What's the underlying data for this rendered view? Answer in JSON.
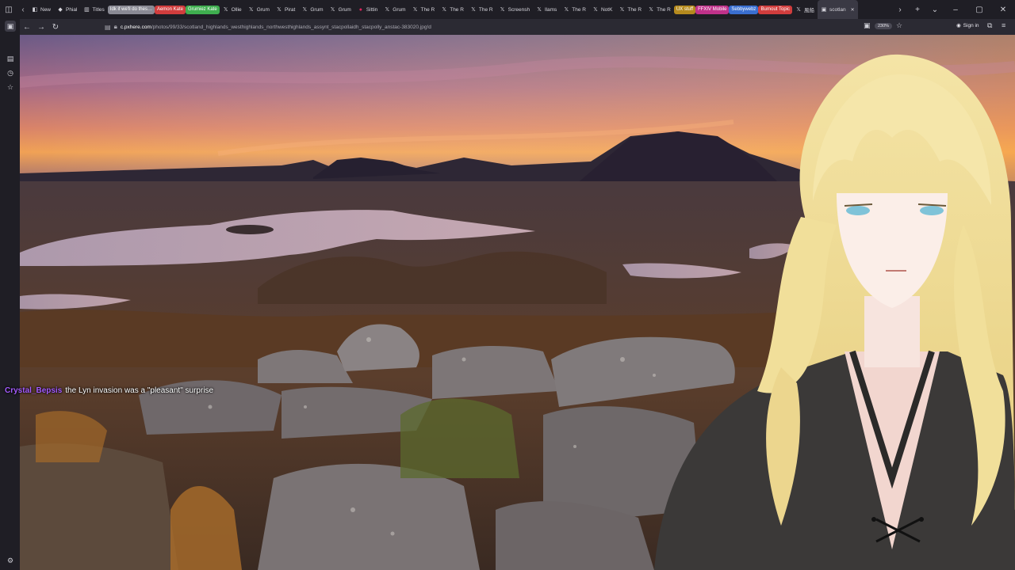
{
  "browser": {
    "tabs": [
      {
        "label": "New",
        "icon": "browser-icon"
      },
      {
        "label": "Phial",
        "icon": "shield-icon"
      },
      {
        "label": "Titles",
        "icon": "doc-icon"
      },
      {
        "label": "Idk if we'll do thes…",
        "group": "#8a8a94"
      },
      {
        "label": "Aemon Kate",
        "group": "#d13d3d"
      },
      {
        "label": "Grumiez Kate",
        "group": "#3fae4f"
      },
      {
        "label": "Ollie",
        "icon": "x-icon"
      },
      {
        "label": "Grum",
        "icon": "x-icon"
      },
      {
        "label": "Pirat",
        "icon": "x-icon"
      },
      {
        "label": "Grum",
        "icon": "x-icon"
      },
      {
        "label": "Grum",
        "icon": "x-icon"
      },
      {
        "label": "Sittin",
        "icon": "record-icon"
      },
      {
        "label": "Grum",
        "icon": "x-icon"
      },
      {
        "label": "The R",
        "icon": "x-icon"
      },
      {
        "label": "The R",
        "icon": "x-icon"
      },
      {
        "label": "The R",
        "icon": "x-icon"
      },
      {
        "label": "Screensh",
        "icon": "x-icon"
      },
      {
        "label": "llams",
        "icon": "x-icon"
      },
      {
        "label": "The R",
        "icon": "x-icon"
      },
      {
        "label": "NotK",
        "icon": "x-icon"
      },
      {
        "label": "The R",
        "icon": "x-icon"
      },
      {
        "label": "The R",
        "icon": "x-icon"
      },
      {
        "label": "UX stuff",
        "group": "#b58a1e"
      },
      {
        "label": "FFXIV Mobile",
        "group": "#c0318a"
      },
      {
        "label": "Sebbywebz",
        "group": "#3a6fd1"
      },
      {
        "label": "Burnout Topic",
        "group": "#d13d3d"
      },
      {
        "label": "風船",
        "icon": "x-icon"
      },
      {
        "label": "scotlan",
        "icon": "image-icon",
        "active": true
      }
    ],
    "url": {
      "prefix": "",
      "host": "c.pxhere.com",
      "path": "/photos/99/33/scotland_highlands_westhighlands_northwesthighlands_assynt_stacpollaidh_stacpolly_anstac-383020.jpg!d"
    },
    "zoom": "230%",
    "signin_label": "Sign in"
  },
  "chat": {
    "username": "Crystal_Bepsis",
    "message": "the Lyn invasion was a \"pleasant\" surprise"
  },
  "colors": {
    "chat_username": "#a55cff"
  }
}
